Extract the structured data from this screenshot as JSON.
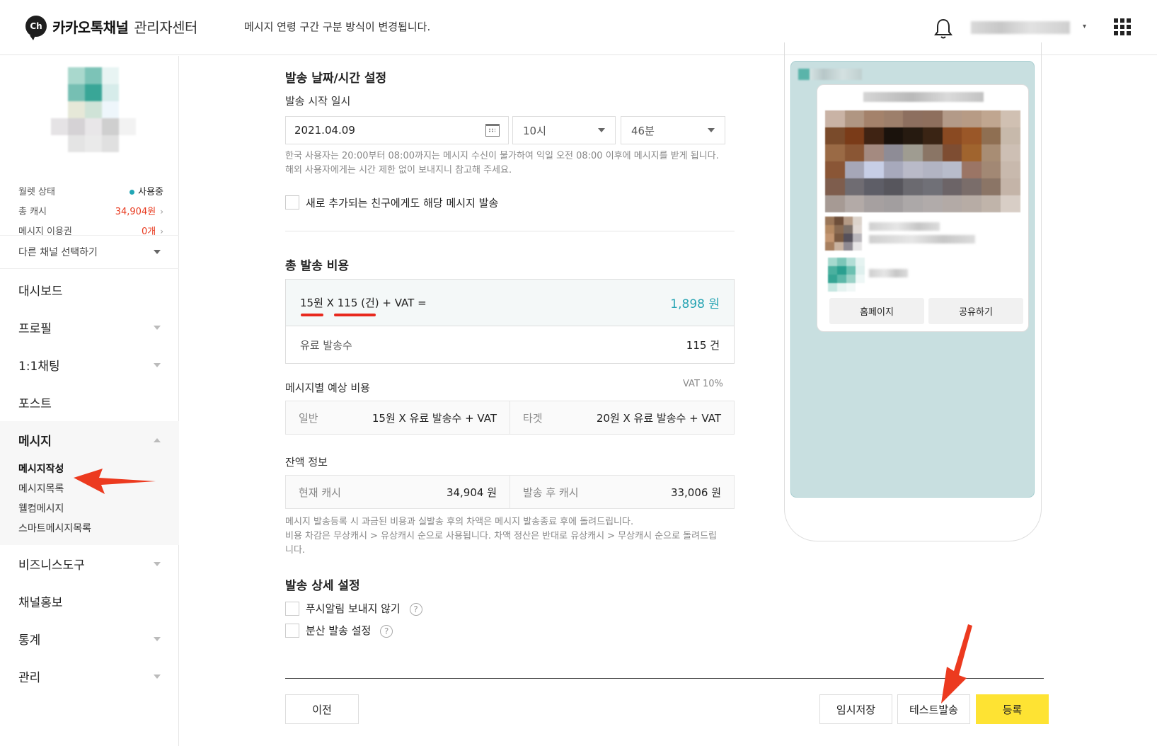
{
  "header": {
    "logo_mark": "Ch",
    "logo_text": "카카오톡채널",
    "logo_sub": "관리자센터",
    "notice": "메시지 연령 구간 구분 방식이 변경됩니다."
  },
  "sidebar": {
    "wallet": {
      "status_label": "월렛 상태",
      "status_value": "사용중",
      "cash_label": "총 캐시",
      "cash_value": "34,904원",
      "voucher_label": "메시지 이용권",
      "voucher_value": "0개"
    },
    "channel_select": "다른 채널 선택하기",
    "nav": [
      "대시보드",
      "프로필",
      "1:1채팅",
      "포스트"
    ],
    "message_group": {
      "label": "메시지",
      "items": [
        "메시지작성",
        "메시지목록",
        "웰컴메시지",
        "스마트메시지목록"
      ]
    },
    "nav_bottom": [
      "비즈니스도구",
      "채널홍보",
      "통계",
      "관리"
    ]
  },
  "schedule": {
    "title": "발송 날짜/시간 설정",
    "start_label": "발송 시작 일시",
    "date": "2021.04.09",
    "hour": "10시",
    "minute": "46분",
    "hint_1": "한국 사용자는 20:00부터 08:00까지는 메시지 수신이 불가하여 익일 오전 08:00 이후에 메시지를 받게 됩니다.",
    "hint_2": "해외 사용자에게는 시간 제한 없이 보내지니 참고해 주세요.",
    "new_friends_label": "새로 추가되는 친구에게도 해당 메시지 발송"
  },
  "cost": {
    "title": "총 발송 비용",
    "unit": "15원",
    "x": "X",
    "count": "115 (건)",
    "vat_suffix": "+ VAT =",
    "total": "1,898 원",
    "paid_label": "유료 발송수",
    "paid_value": "115 건",
    "per_message_label": "메시지별 예상 비용",
    "vat_note": "VAT 10%",
    "normal_label": "일반",
    "normal_value": "15원 X 유료 발송수 + VAT",
    "target_label": "타겟",
    "target_value": "20원 X 유료 발송수 + VAT",
    "balance_label": "잔액 정보",
    "current_label": "현재 캐시",
    "current_value": "34,904 원",
    "after_label": "발송 후 캐시",
    "after_value": "33,006 원",
    "refund_1": "메시지 발송등록 시 과금된 비용과 실발송 후의 차액은 메시지 발송종료 후에 돌려드립니다.",
    "refund_2": "비용 차감은 무상캐시 > 유상캐시 순으로 사용됩니다. 차액 정산은 반대로 유상캐시 > 무상캐시 순으로 돌려드립",
    "refund_3": "니다."
  },
  "detail": {
    "title": "발송 상세 설정",
    "no_push": "푸시알림 보내지 않기",
    "split_send": "분산 발송 설정",
    "help": "?"
  },
  "buttons": {
    "prev": "이전",
    "save_draft": "임시저장",
    "test_send": "테스트발송",
    "register": "등록"
  },
  "preview": {
    "homepage": "홈페이지",
    "share": "공유하기"
  },
  "colors": {
    "accent_teal": "#27a4b3",
    "register_yellow": "#fee333",
    "alert_red": "#e8391e"
  }
}
